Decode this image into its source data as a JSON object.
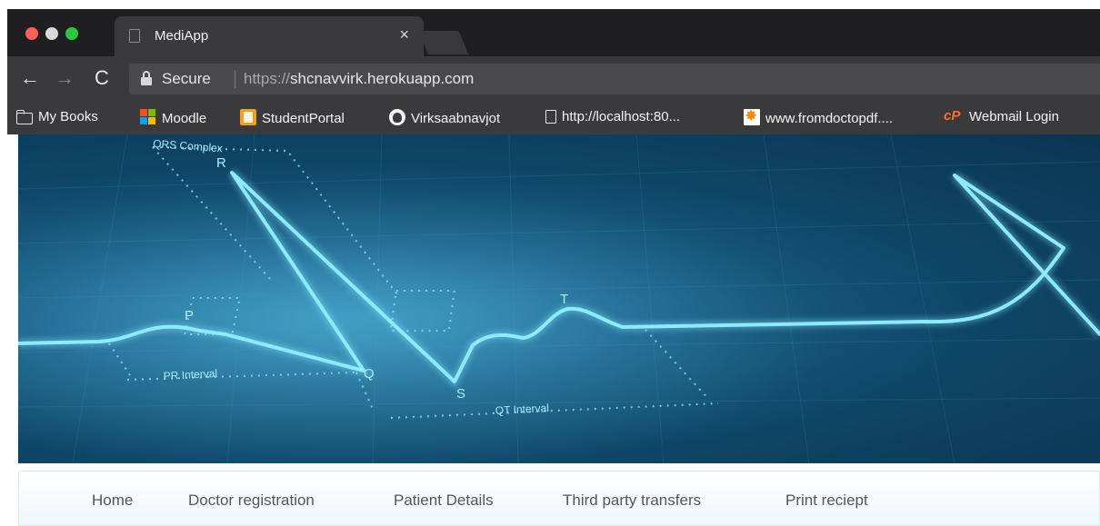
{
  "browser": {
    "tab_title": "MediApp",
    "tab_close": "×",
    "nav": {
      "back": "←",
      "forward": "→",
      "reload": "C"
    },
    "address": {
      "secure_label": "Secure",
      "url_protocol": "https://",
      "url_host": "shcnavvirk.herokuapp.com"
    },
    "bookmarks": [
      {
        "label": "My Books",
        "icon": "folder-icon"
      },
      {
        "label": "Moodle",
        "icon": "microsoft-icon"
      },
      {
        "label": "StudentPortal",
        "icon": "student-portal-icon"
      },
      {
        "label": "Virksaabnavjot",
        "icon": "github-icon"
      },
      {
        "label": "http://localhost:80...",
        "icon": "page-icon"
      },
      {
        "label": "www.fromdoctopdf....",
        "icon": "fromdoctopdf-icon"
      },
      {
        "label": "Webmail Login",
        "icon": "cpanel-icon"
      }
    ]
  },
  "hero": {
    "labels": {
      "qrs": "QRS Complex",
      "r": "R",
      "p": "P",
      "q": "Q",
      "s": "S",
      "t": "T",
      "pr_interval": "PR Interval",
      "qt_interval": "QT Interval"
    },
    "colors": {
      "trace": "#7fe6ff",
      "background": "#0e4566"
    }
  },
  "navbar": {
    "items": [
      "Home",
      "Doctor registration",
      "Patient Details",
      "Third party transfers",
      "Print reciept"
    ]
  }
}
